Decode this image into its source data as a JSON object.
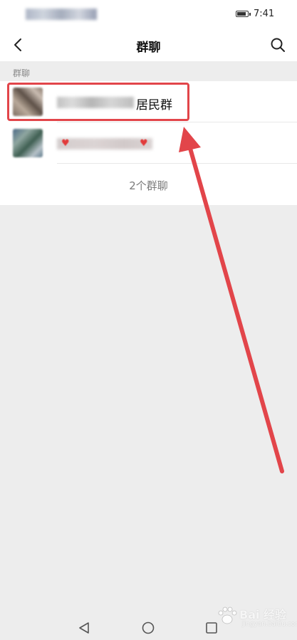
{
  "status_bar": {
    "time": "7:41",
    "battery_icon": "battery-icon"
  },
  "nav_bar": {
    "back_icon": "back-chevron-icon",
    "title": "群聊",
    "search_icon": "search-icon"
  },
  "section": {
    "label": "群聊"
  },
  "groups": [
    {
      "name_visible_suffix": "居民群",
      "name_blurred": true
    },
    {
      "name_visible_suffix": "",
      "name_blurred": true,
      "decoration": "heart-icon"
    }
  ],
  "footer": {
    "count_text": "2个群聊"
  },
  "annotation": {
    "highlight_color": "#e2454a"
  },
  "bottom_nav": {
    "back_icon": "triangle-back-icon",
    "home_icon": "circle-home-icon",
    "recent_icon": "square-recent-icon"
  },
  "watermark": {
    "text": "Bai 经验",
    "sub": "jingyan.baidu.com"
  }
}
